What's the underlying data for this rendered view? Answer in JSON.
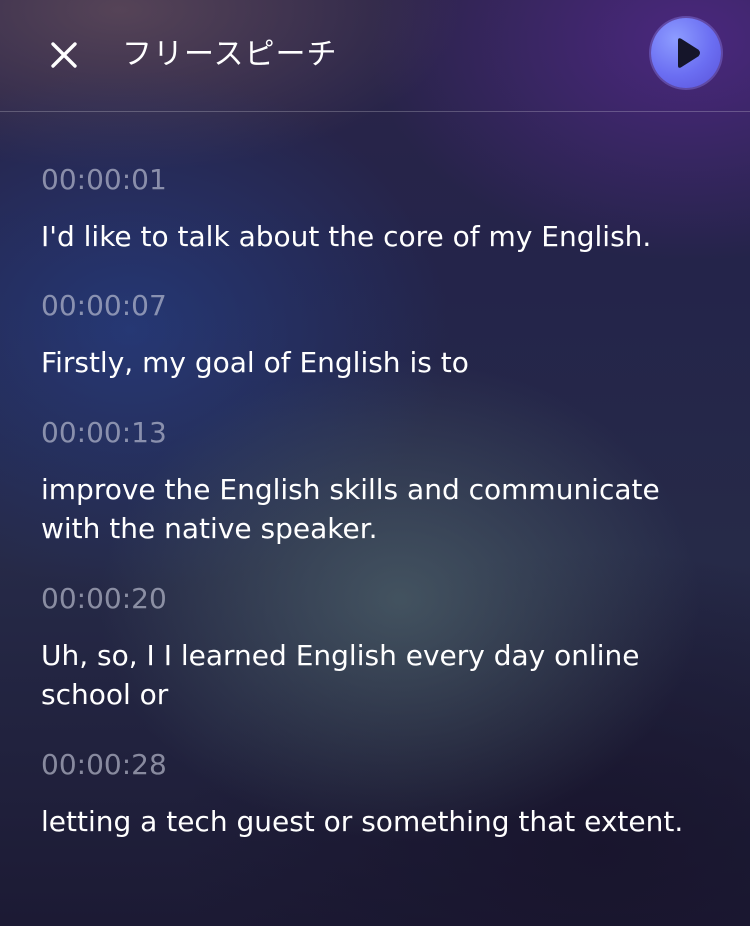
{
  "header": {
    "close_icon": "close-icon",
    "title": "フリースピーチ",
    "play_icon": "play-icon",
    "play_color": "#6b6ef2"
  },
  "transcript": [
    {
      "time": "00:00:01",
      "text": "I'd like to talk about the core of my English."
    },
    {
      "time": "00:00:07",
      "text": "Firstly, my goal of English is to"
    },
    {
      "time": "00:00:13",
      "text": "improve the English skills and communicate with the native speaker."
    },
    {
      "time": "00:00:20",
      "text": "Uh, so, I I learned English every day online school or"
    },
    {
      "time": "00:00:28",
      "text": "letting a tech guest or something that extent."
    }
  ]
}
